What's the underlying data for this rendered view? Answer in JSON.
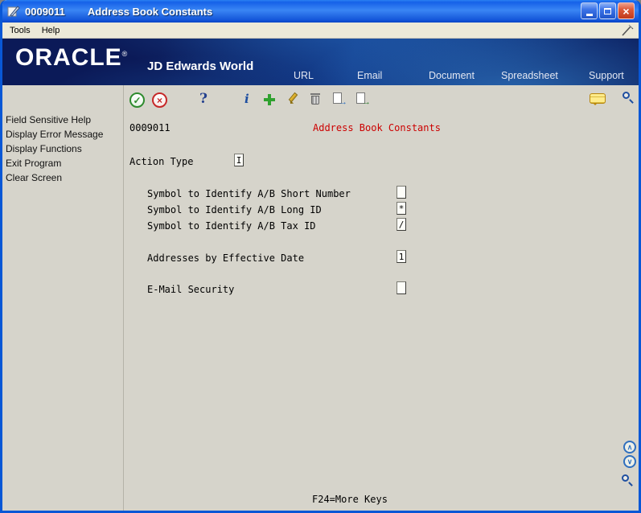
{
  "window": {
    "id": "0009011",
    "title": "Address Book Constants",
    "close_glyph": "×"
  },
  "menu": {
    "tools": "Tools",
    "help": "Help"
  },
  "banner": {
    "logo": "ORACLE",
    "registered": "®",
    "product": "JD Edwards World",
    "links": [
      "URL",
      "Email",
      "Document",
      "Spreadsheet",
      "Support"
    ]
  },
  "sidebar": {
    "items": [
      "Field Sensitive Help",
      "Display Error Message",
      "Display Functions",
      "Exit Program",
      "Clear Screen"
    ]
  },
  "toolbar": {
    "glyphs": {
      "ok": "✓",
      "cancel": "×",
      "help": "?",
      "info": "i",
      "export_arrow": "→",
      "import_arrow": "→"
    },
    "icon_names": [
      "ok",
      "cancel",
      "help",
      "info",
      "add",
      "edit",
      "delete",
      "export",
      "import",
      "messages",
      "search"
    ]
  },
  "form": {
    "program_id": "0009011",
    "title": "Address Book Constants",
    "action_type_label": "Action Type",
    "action_type_value": "I",
    "fields": [
      {
        "label": "Symbol to Identify A/B Short Number",
        "value": ""
      },
      {
        "label": "Symbol to Identify A/B Long ID",
        "value": "*"
      },
      {
        "label": "Symbol to Identify A/B Tax ID",
        "value": "/"
      },
      {
        "label": "Addresses by Effective Date",
        "value": "1"
      },
      {
        "label": "E-Mail Security",
        "value": ""
      }
    ],
    "footer": "F24=More Keys"
  },
  "nav": {
    "up": "∧",
    "down": "∨"
  }
}
